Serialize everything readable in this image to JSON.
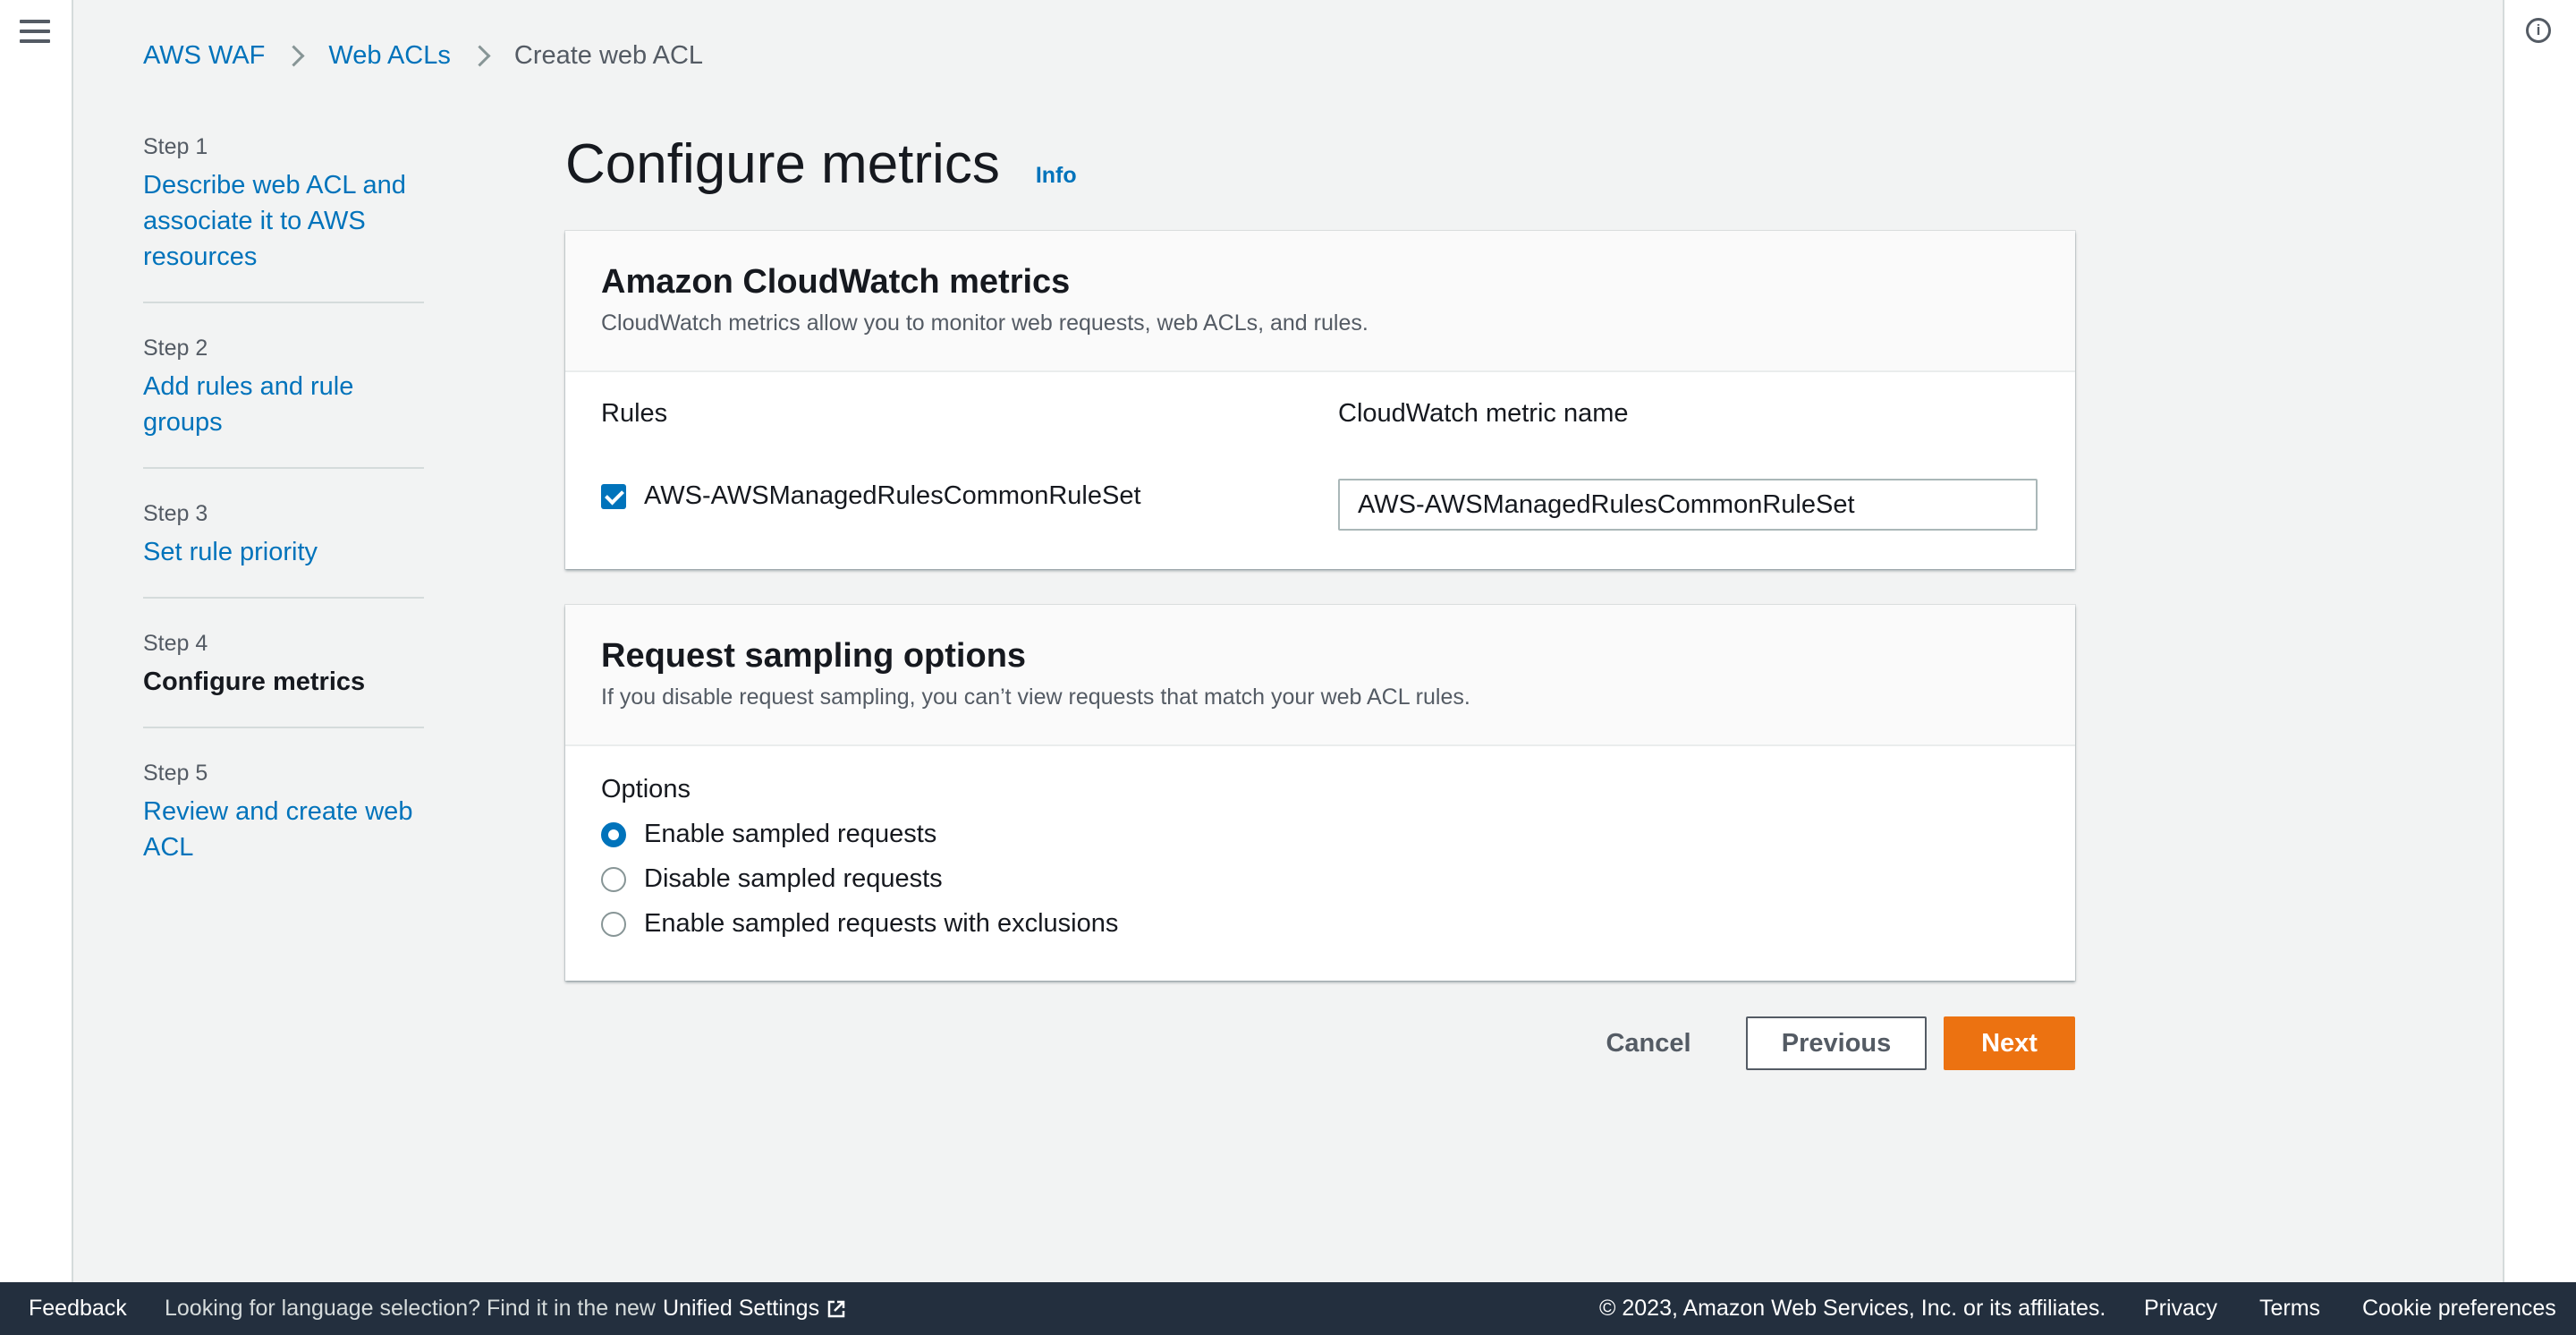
{
  "breadcrumb": {
    "items": [
      {
        "label": "AWS WAF"
      },
      {
        "label": "Web ACLs"
      },
      {
        "label": "Create web ACL"
      }
    ]
  },
  "steps": [
    {
      "num": "Step 1",
      "label": "Describe web ACL and associate it to AWS resources"
    },
    {
      "num": "Step 2",
      "label": "Add rules and rule groups"
    },
    {
      "num": "Step 3",
      "label": "Set rule priority"
    },
    {
      "num": "Step 4",
      "label": "Configure metrics",
      "current": true
    },
    {
      "num": "Step 5",
      "label": "Review and create web ACL"
    }
  ],
  "page": {
    "title": "Configure metrics",
    "info_label": "Info"
  },
  "cloudwatch": {
    "title": "Amazon CloudWatch metrics",
    "description": "CloudWatch metrics allow you to monitor web requests, web ACLs, and rules.",
    "rules_header": "Rules",
    "metric_header": "CloudWatch metric name",
    "rule": {
      "name": "AWS-AWSManagedRulesCommonRuleSet",
      "checked": true,
      "metric_name": "AWS-AWSManagedRulesCommonRuleSet"
    }
  },
  "sampling": {
    "title": "Request sampling options",
    "description": "If you disable request sampling, you can’t view requests that match your web ACL rules.",
    "options_label": "Options",
    "options": [
      {
        "label": "Enable sampled requests",
        "selected": true
      },
      {
        "label": "Disable sampled requests",
        "selected": false
      },
      {
        "label": "Enable sampled requests with exclusions",
        "selected": false
      }
    ]
  },
  "actions": {
    "cancel": "Cancel",
    "previous": "Previous",
    "next": "Next"
  },
  "footer": {
    "feedback": "Feedback",
    "language_text": "Looking for language selection? Find it in the new",
    "unified_settings": "Unified Settings",
    "copyright": "© 2023, Amazon Web Services, Inc. or its affiliates.",
    "privacy": "Privacy",
    "terms": "Terms",
    "cookie": "Cookie preferences"
  },
  "icons": {
    "menu": "hamburger-menu-icon",
    "info": "info-circle-icon",
    "breadcrumb_separator": "chevron-right-icon",
    "external": "external-link-icon"
  },
  "colors": {
    "link": "#0073bb",
    "primary_button": "#ec7211",
    "footer_bg": "#232f3e"
  }
}
